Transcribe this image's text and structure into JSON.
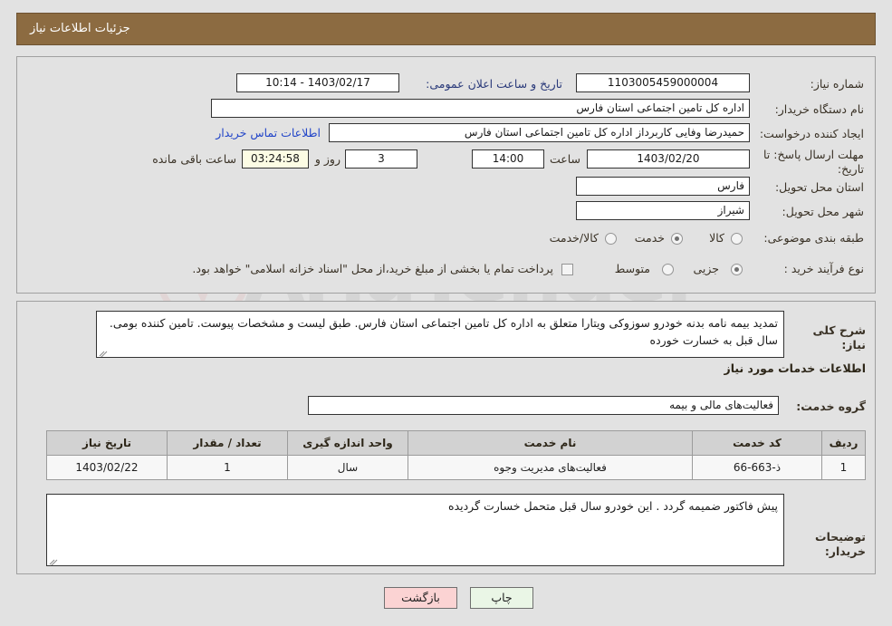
{
  "header": {
    "title": "جزئیات اطلاعات نیاز"
  },
  "watermark": {
    "text": "AriaTender",
    "logo": "shield-logo"
  },
  "need_info": {
    "need_number": {
      "label": "شماره نیاز:",
      "value": "1103005459000004"
    },
    "announce_datetime": {
      "label": "تاریخ و ساعت اعلان عمومی:",
      "value": "1403/02/17 - 10:14"
    },
    "buyer_org": {
      "label": "نام دستگاه خریدار:",
      "value": "اداره کل تامین اجتماعی استان فارس"
    },
    "request_creator": {
      "label": "ایجاد کننده درخواست:",
      "value": "حمیدرضا وفایی کاربرداز اداره کل تامین اجتماعی استان فارس"
    },
    "buyer_contact_link": "اطلاعات تماس خریدار",
    "deadline": {
      "label": "مهلت ارسال پاسخ: تا تاریخ:",
      "date": "1403/02/20",
      "time_label": "ساعت",
      "time": "14:00",
      "days": "3",
      "days_suffix": "روز و",
      "countdown": "03:24:58",
      "countdown_suffix": "ساعت باقی مانده"
    },
    "delivery_province": {
      "label": "استان محل تحویل:",
      "value": "فارس"
    },
    "delivery_city": {
      "label": "شهر محل تحویل:",
      "value": "شیراز"
    },
    "subject_classification": {
      "label": "طبقه بندی موضوعی:",
      "options": [
        "کالا",
        "خدمت",
        "کالا/خدمت"
      ],
      "selected": "خدمت"
    },
    "purchase_process": {
      "label": "نوع فرآیند خرید :",
      "options": [
        "جزیی",
        "متوسط"
      ],
      "selected": "جزیی"
    },
    "treasury_note": {
      "checked": false,
      "text": "پرداخت تمام یا بخشی از مبلغ خرید،از محل \"اسناد خزانه اسلامی\" خواهد بود."
    }
  },
  "need_description": {
    "label": "شرح کلی نیاز:",
    "value": "تمدید بیمه نامه بدنه خودرو سوزوکی ویتارا متعلق به اداره کل تامین اجتماعی استان فارس. طبق لیست و مشخصات پیوست. تامین کننده بومی. سال قبل به خسارت خورده"
  },
  "services_section": {
    "title": "اطلاعات خدمات مورد نیاز",
    "service_group": {
      "label": "گروه خدمت:",
      "value": "فعالیت‌های مالی و بیمه"
    },
    "table": {
      "columns": [
        "ردیف",
        "کد خدمت",
        "نام خدمت",
        "واحد اندازه گیری",
        "تعداد / مقدار",
        "تاریخ نیاز"
      ],
      "rows": [
        [
          "1",
          "ذ-663-66",
          "فعالیت‌های مدیریت وجوه",
          "سال",
          "1",
          "1403/02/22"
        ]
      ]
    }
  },
  "buyer_notes": {
    "label": "توضیحات خریدار:",
    "value": "پیش فاکتور ضمیمه گردد . این خودرو سال قبل متحمل خسارت گردیده"
  },
  "footer": {
    "print_label": "چاپ",
    "back_label": "بازگشت"
  },
  "colors": {
    "header_bg": "#8c6b41",
    "page_bg": "#e2e2e2",
    "link": "#2346c8",
    "timer_bg": "#fcfce4",
    "print_btn": "#eaf6e6",
    "back_btn": "#fbd3d3"
  }
}
